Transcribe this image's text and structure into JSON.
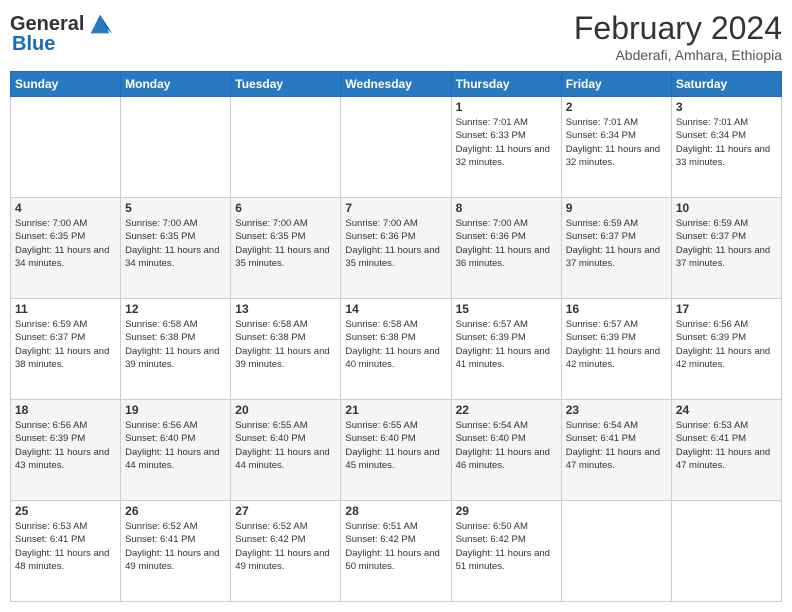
{
  "header": {
    "logo_general": "General",
    "logo_blue": "Blue",
    "month_title": "February 2024",
    "subtitle": "Abderafi, Amhara, Ethiopia"
  },
  "calendar": {
    "headers": [
      "Sunday",
      "Monday",
      "Tuesday",
      "Wednesday",
      "Thursday",
      "Friday",
      "Saturday"
    ],
    "weeks": [
      [
        {
          "day": "",
          "info": ""
        },
        {
          "day": "",
          "info": ""
        },
        {
          "day": "",
          "info": ""
        },
        {
          "day": "",
          "info": ""
        },
        {
          "day": "1",
          "info": "Sunrise: 7:01 AM\nSunset: 6:33 PM\nDaylight: 11 hours\nand 32 minutes."
        },
        {
          "day": "2",
          "info": "Sunrise: 7:01 AM\nSunset: 6:34 PM\nDaylight: 11 hours\nand 32 minutes."
        },
        {
          "day": "3",
          "info": "Sunrise: 7:01 AM\nSunset: 6:34 PM\nDaylight: 11 hours\nand 33 minutes."
        }
      ],
      [
        {
          "day": "4",
          "info": "Sunrise: 7:00 AM\nSunset: 6:35 PM\nDaylight: 11 hours\nand 34 minutes."
        },
        {
          "day": "5",
          "info": "Sunrise: 7:00 AM\nSunset: 6:35 PM\nDaylight: 11 hours\nand 34 minutes."
        },
        {
          "day": "6",
          "info": "Sunrise: 7:00 AM\nSunset: 6:35 PM\nDaylight: 11 hours\nand 35 minutes."
        },
        {
          "day": "7",
          "info": "Sunrise: 7:00 AM\nSunset: 6:36 PM\nDaylight: 11 hours\nand 35 minutes."
        },
        {
          "day": "8",
          "info": "Sunrise: 7:00 AM\nSunset: 6:36 PM\nDaylight: 11 hours\nand 36 minutes."
        },
        {
          "day": "9",
          "info": "Sunrise: 6:59 AM\nSunset: 6:37 PM\nDaylight: 11 hours\nand 37 minutes."
        },
        {
          "day": "10",
          "info": "Sunrise: 6:59 AM\nSunset: 6:37 PM\nDaylight: 11 hours\nand 37 minutes."
        }
      ],
      [
        {
          "day": "11",
          "info": "Sunrise: 6:59 AM\nSunset: 6:37 PM\nDaylight: 11 hours\nand 38 minutes."
        },
        {
          "day": "12",
          "info": "Sunrise: 6:58 AM\nSunset: 6:38 PM\nDaylight: 11 hours\nand 39 minutes."
        },
        {
          "day": "13",
          "info": "Sunrise: 6:58 AM\nSunset: 6:38 PM\nDaylight: 11 hours\nand 39 minutes."
        },
        {
          "day": "14",
          "info": "Sunrise: 6:58 AM\nSunset: 6:38 PM\nDaylight: 11 hours\nand 40 minutes."
        },
        {
          "day": "15",
          "info": "Sunrise: 6:57 AM\nSunset: 6:39 PM\nDaylight: 11 hours\nand 41 minutes."
        },
        {
          "day": "16",
          "info": "Sunrise: 6:57 AM\nSunset: 6:39 PM\nDaylight: 11 hours\nand 42 minutes."
        },
        {
          "day": "17",
          "info": "Sunrise: 6:56 AM\nSunset: 6:39 PM\nDaylight: 11 hours\nand 42 minutes."
        }
      ],
      [
        {
          "day": "18",
          "info": "Sunrise: 6:56 AM\nSunset: 6:39 PM\nDaylight: 11 hours\nand 43 minutes."
        },
        {
          "day": "19",
          "info": "Sunrise: 6:56 AM\nSunset: 6:40 PM\nDaylight: 11 hours\nand 44 minutes."
        },
        {
          "day": "20",
          "info": "Sunrise: 6:55 AM\nSunset: 6:40 PM\nDaylight: 11 hours\nand 44 minutes."
        },
        {
          "day": "21",
          "info": "Sunrise: 6:55 AM\nSunset: 6:40 PM\nDaylight: 11 hours\nand 45 minutes."
        },
        {
          "day": "22",
          "info": "Sunrise: 6:54 AM\nSunset: 6:40 PM\nDaylight: 11 hours\nand 46 minutes."
        },
        {
          "day": "23",
          "info": "Sunrise: 6:54 AM\nSunset: 6:41 PM\nDaylight: 11 hours\nand 47 minutes."
        },
        {
          "day": "24",
          "info": "Sunrise: 6:53 AM\nSunset: 6:41 PM\nDaylight: 11 hours\nand 47 minutes."
        }
      ],
      [
        {
          "day": "25",
          "info": "Sunrise: 6:53 AM\nSunset: 6:41 PM\nDaylight: 11 hours\nand 48 minutes."
        },
        {
          "day": "26",
          "info": "Sunrise: 6:52 AM\nSunset: 6:41 PM\nDaylight: 11 hours\nand 49 minutes."
        },
        {
          "day": "27",
          "info": "Sunrise: 6:52 AM\nSunset: 6:42 PM\nDaylight: 11 hours\nand 49 minutes."
        },
        {
          "day": "28",
          "info": "Sunrise: 6:51 AM\nSunset: 6:42 PM\nDaylight: 11 hours\nand 50 minutes."
        },
        {
          "day": "29",
          "info": "Sunrise: 6:50 AM\nSunset: 6:42 PM\nDaylight: 11 hours\nand 51 minutes."
        },
        {
          "day": "",
          "info": ""
        },
        {
          "day": "",
          "info": ""
        }
      ]
    ]
  }
}
